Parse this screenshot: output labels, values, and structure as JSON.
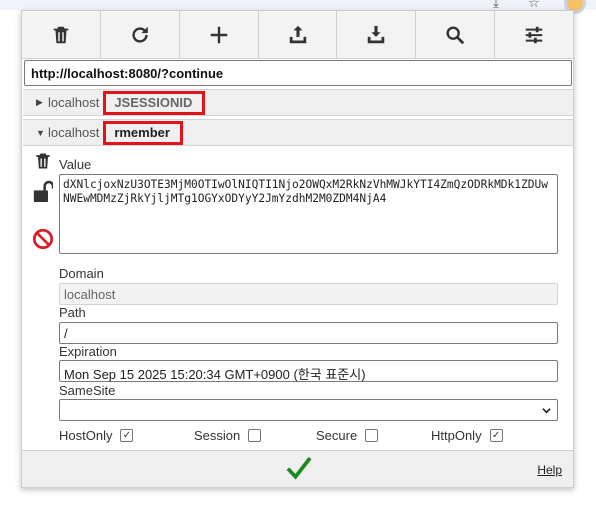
{
  "browser": {
    "icons": [
      "download-icon",
      "star-icon",
      "extension-icon"
    ]
  },
  "toolbar": {
    "buttons": [
      {
        "name": "delete-all-button",
        "icon": "trash-icon"
      },
      {
        "name": "refresh-button",
        "icon": "refresh-icon"
      },
      {
        "name": "add-cookie-button",
        "icon": "plus-icon"
      },
      {
        "name": "import-button",
        "icon": "upload-icon"
      },
      {
        "name": "export-button",
        "icon": "download-icon"
      },
      {
        "name": "search-button",
        "icon": "search-icon"
      },
      {
        "name": "options-button",
        "icon": "sliders-icon"
      }
    ]
  },
  "url": "http://localhost:8080/?continue",
  "cookies": [
    {
      "domain": "localhost",
      "name": "JSESSIONID",
      "expanded": false
    },
    {
      "domain": "localhost",
      "name": "rmember",
      "expanded": true
    }
  ],
  "editor": {
    "value_label": "Value",
    "value": "dXNlcjoxNzU3OTE3MjM0OTIwOlNIQTI1Njo2OWQxM2RkNzVhMWJkYTI4ZmQzODRkMDk1ZDUwNWEwMDMzZjRkYjljMTg1OGYxODYyY2JmYzdhM2M0ZDM4NjA4",
    "domain_label": "Domain",
    "domain": "localhost",
    "path_label": "Path",
    "path": "/",
    "expiration_label": "Expiration",
    "expiration": "Mon Sep 15 2025 15:20:34 GMT+0900 (한국 표준시)",
    "samesite_label": "SameSite",
    "samesite": "",
    "flags": {
      "hostonly_label": "HostOnly",
      "hostonly": true,
      "session_label": "Session",
      "session": false,
      "secure_label": "Secure",
      "secure": false,
      "httponly_label": "HttpOnly",
      "httponly": true
    }
  },
  "footer": {
    "help_label": "Help"
  },
  "colors": {
    "highlight": "#e0141a",
    "accent_check": "#1e8a1e",
    "block_icon": "#d81f26"
  }
}
